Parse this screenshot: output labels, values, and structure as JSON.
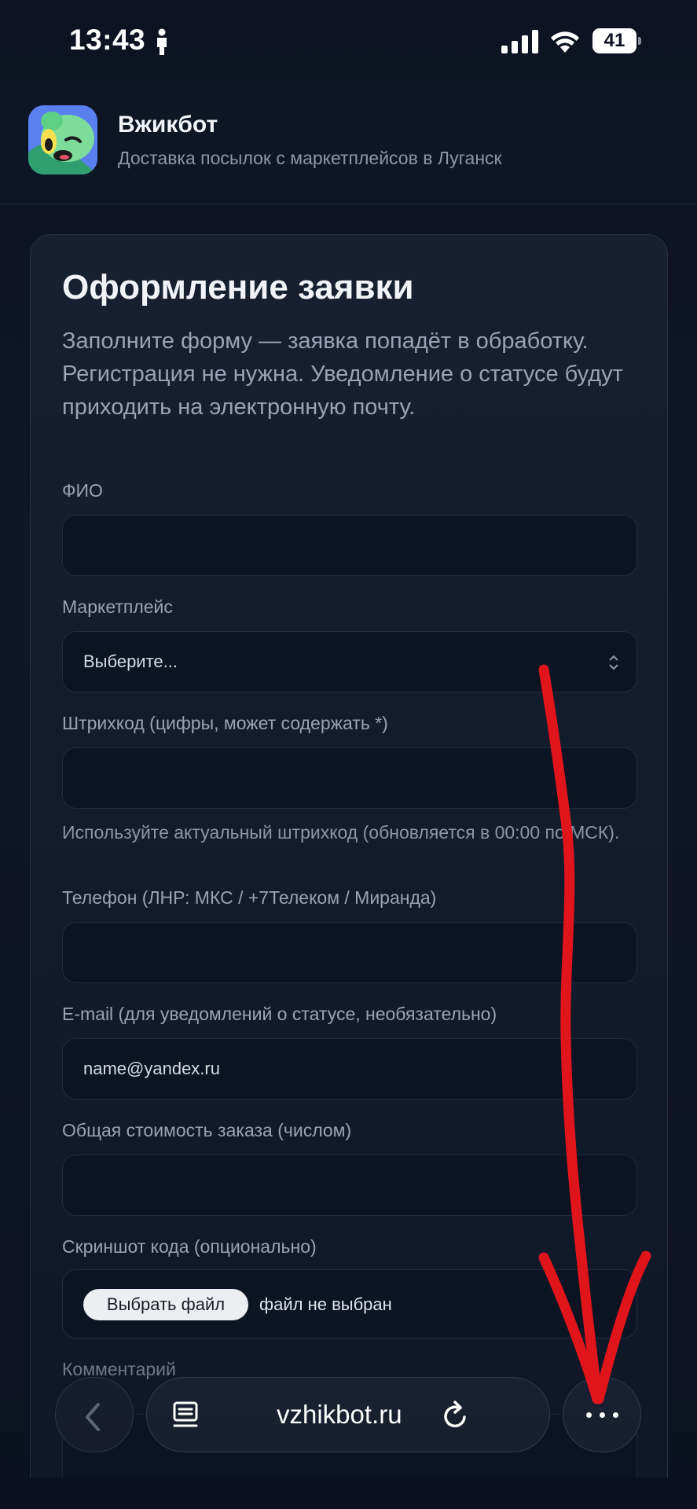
{
  "status_bar": {
    "time": "13:43",
    "battery": "41"
  },
  "app": {
    "title": "Вжикбот",
    "subtitle": "Доставка посылок с маркетплейсов в Луганск"
  },
  "form": {
    "title": "Оформление заявки",
    "description": "Заполните форму — заявка попадёт в обработку. Регистрация не нужна. Уведомление о статусе будут приходить на электронную почту.",
    "fio_label": "ФИО",
    "fio_value": "",
    "marketplace_label": "Маркетплейс",
    "marketplace_value": "Выберите...",
    "barcode_label": "Штрихкод (цифры, может содержать *)",
    "barcode_value": "",
    "barcode_hint": "Используйте актуальный штрихкод (обновляется в 00:00 по МСК).",
    "phone_label": "Телефон (ЛНР: МКС / +7Телеком / Миранда)",
    "phone_value": "",
    "email_label": "E-mail (для уведомлений о статусе, необязательно)",
    "email_placeholder": "name@yandex.ru",
    "total_label": "Общая стоимость заказа (числом)",
    "total_value": "",
    "screenshot_label": "Скриншот кода (опционально)",
    "file_button": "Выбрать файл",
    "file_status": "файл не выбран",
    "comment_label": "Комментарий"
  },
  "browser": {
    "url": "vzhikbot.ru"
  },
  "colors": {
    "background": "#0c1220",
    "card": "#162031",
    "annotation": "#e0141b"
  },
  "icons": [
    "person-icon",
    "signal-icon",
    "wifi-icon",
    "battery-icon",
    "chevron-updown-icon",
    "back-arrow-icon",
    "tabs-icon",
    "reload-icon",
    "more-icon"
  ]
}
